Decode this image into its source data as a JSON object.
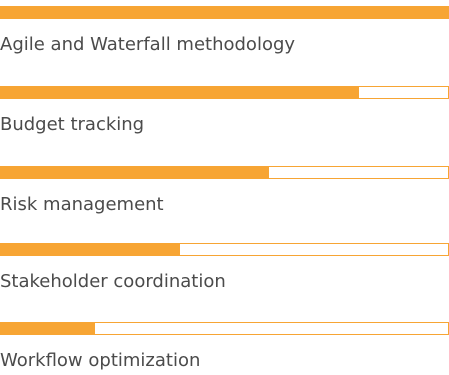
{
  "accent_color": "#f7a534",
  "skills": [
    {
      "label": "Agile and Waterfall methodology",
      "level": 1.0
    },
    {
      "label": "Budget tracking",
      "level": 0.8
    },
    {
      "label": "Risk management",
      "level": 0.6
    },
    {
      "label": "Stakeholder coordination",
      "level": 0.4
    },
    {
      "label": "Workflow optimization",
      "level": 0.21
    }
  ]
}
